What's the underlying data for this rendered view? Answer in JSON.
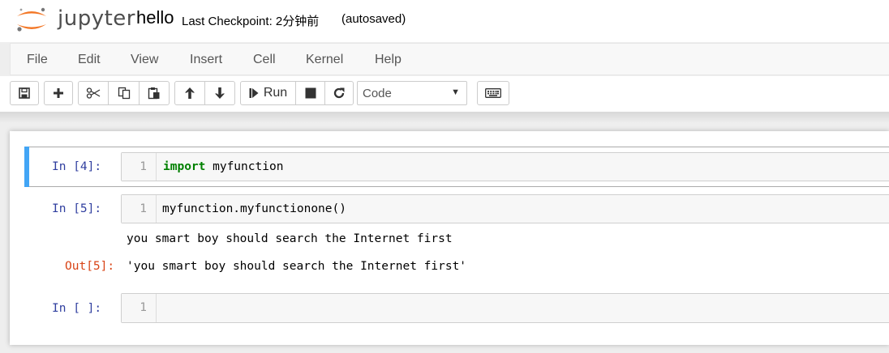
{
  "header": {
    "logo_text": "jupyter",
    "notebook_name": "hello",
    "checkpoint": "Last Checkpoint: 2分钟前",
    "autosave": "(autosaved)"
  },
  "menu": {
    "items": [
      "File",
      "Edit",
      "View",
      "Insert",
      "Cell",
      "Kernel",
      "Help"
    ]
  },
  "toolbar": {
    "run_label": "Run",
    "cell_type": "Code",
    "icons": [
      "save-icon",
      "plus-icon",
      "cut-icon",
      "copy-icon",
      "paste-icon",
      "arrow-up-icon",
      "arrow-down-icon",
      "step-forward-icon",
      "stop-icon",
      "restart-icon",
      "keyboard-icon"
    ]
  },
  "cells": [
    {
      "prompt": "In [4]:",
      "line_number": "1",
      "code_keyword": "import",
      "code_rest": " myfunction",
      "selected": true
    },
    {
      "prompt": "In [5]:",
      "line_number": "1",
      "code": "myfunction.myfunctionone()",
      "stream_output": "you smart boy should search the Internet first",
      "out_prompt": "Out[5]:",
      "result": "'you smart boy should search the Internet first'"
    },
    {
      "prompt": "In [ ]:",
      "line_number": "1",
      "code": ""
    }
  ],
  "colors": {
    "selected_bar": "#42a5f5",
    "in_prompt": "#303f9f",
    "out_prompt": "#d84315",
    "keyword": "#008000",
    "logo_orange": "#f37726"
  }
}
